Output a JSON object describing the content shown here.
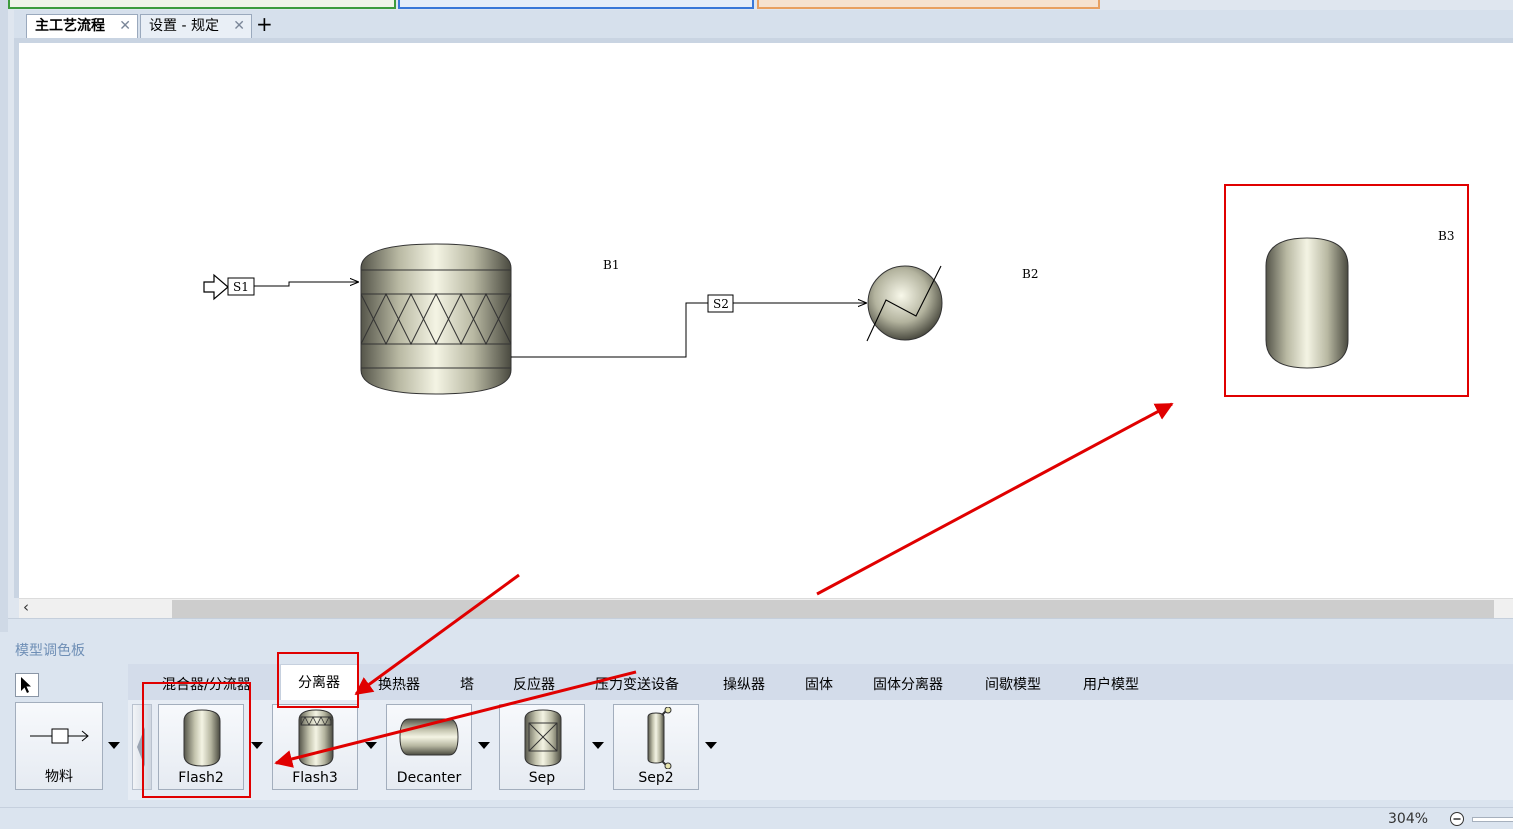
{
  "tabs": [
    {
      "label": "主工艺流程",
      "close": "✕"
    },
    {
      "label": "设置 - 规定",
      "close": "✕"
    }
  ],
  "add_tab": "+",
  "flowsheet": {
    "blocks": [
      {
        "id": "B1",
        "type": "packed-column"
      },
      {
        "id": "B2",
        "type": "heater"
      },
      {
        "id": "B3",
        "type": "flash2"
      }
    ],
    "streams": [
      "S1",
      "S2"
    ]
  },
  "palette": {
    "title": "模型调色板",
    "categories": [
      "混合器/分流器",
      "分离器",
      "换热器",
      "塔",
      "反应器",
      "压力变送设备",
      "操纵器",
      "固体",
      "固体分离器",
      "间歇模型",
      "用户模型"
    ],
    "active_category": "分离器",
    "material_label": "物料",
    "models": [
      "Flash2",
      "Flash3",
      "Decanter",
      "Sep",
      "Sep2"
    ]
  },
  "status": {
    "zoom": "304%"
  },
  "colors": {
    "annotation_red": "#e00000",
    "tab_accent_green": "#3d9b3d",
    "tab_accent_blue": "#3a78d8",
    "tab_accent_orange": "#e8a060"
  }
}
